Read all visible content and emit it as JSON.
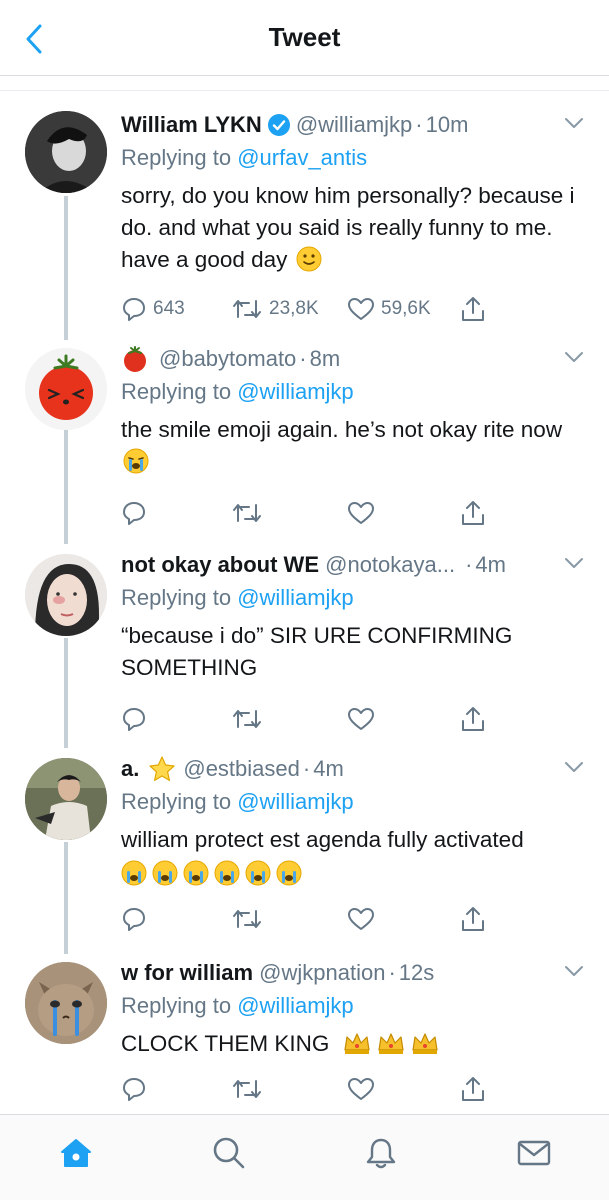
{
  "header": {
    "title": "Tweet"
  },
  "colors": {
    "accent": "#1da1f2",
    "muted": "#657786",
    "text": "#14171a",
    "thread": "#c4cfd6"
  },
  "icons": {
    "back": "chevron-left-icon",
    "reply": "comment-icon",
    "retweet": "retweet-icon",
    "like": "heart-icon",
    "share": "share-icon"
  },
  "tweets": [
    {
      "name": "William LYKN",
      "verified": true,
      "handle": "@williamjkp",
      "dot": "·",
      "time": "10m",
      "reply_prefix": "Replying to",
      "reply_to": "@urfav_antis",
      "text": "sorry, do you know him personally? because i do. and what you said is really funny to me. have a good day",
      "counts": {
        "replies": "643",
        "retweets": "23,8K",
        "likes": "59,6K"
      }
    },
    {
      "name": "",
      "handle": "@babytomato",
      "dot": "·",
      "time": "8m",
      "reply_prefix": "Replying to",
      "reply_to": "@williamjkp",
      "text": "the smile emoji again. he’s not okay rite now"
    },
    {
      "name": "not okay about WE",
      "handle": "@notokaya...",
      "dot": "·",
      "time": "4m",
      "reply_prefix": "Replying to",
      "reply_to": "@williamjkp",
      "text": "“because i do” SIR URE CONFIRMING SOMETHING"
    },
    {
      "name": "a.",
      "handle": "@estbiased",
      "dot": "·",
      "time": "4m",
      "reply_prefix": "Replying to",
      "reply_to": "@williamjkp",
      "text": "william protect est agenda fully activated"
    },
    {
      "name": "w for william",
      "handle": "@wjkpnation",
      "dot": "·",
      "time": "12s",
      "reply_prefix": "Replying to",
      "reply_to": "@williamjkp",
      "text": "CLOCK THEM KING"
    }
  ],
  "tabbar": [
    "home-icon",
    "search-icon",
    "notifications-icon",
    "messages-icon"
  ]
}
